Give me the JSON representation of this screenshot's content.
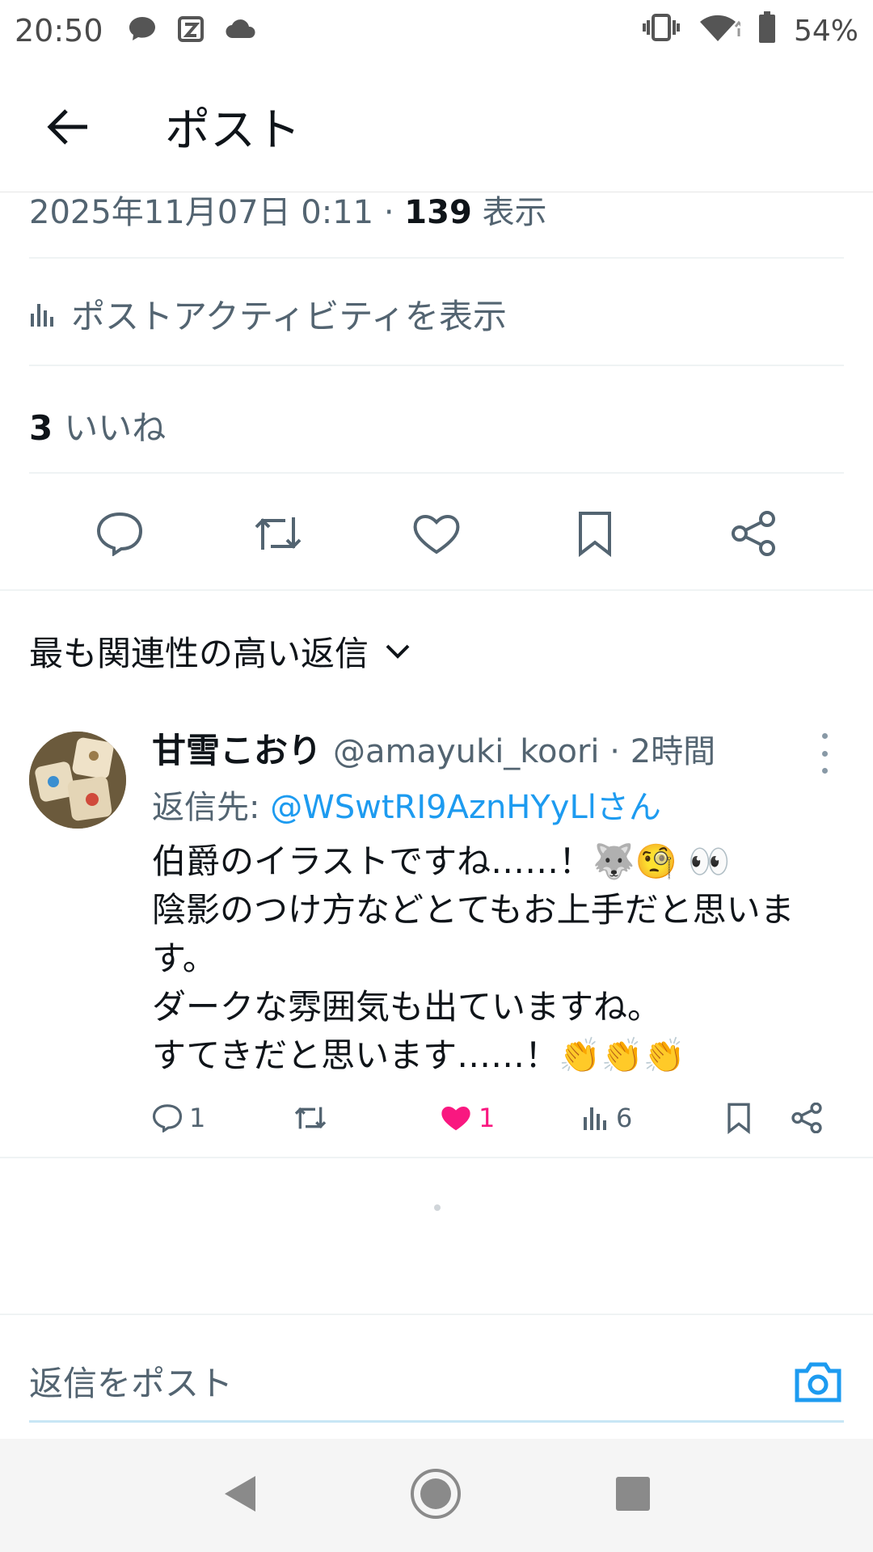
{
  "status_bar": {
    "time": "20:50",
    "battery": "54%",
    "left_icons": [
      "message-bubble-icon",
      "app-notification-icon",
      "cloud-icon"
    ],
    "right_icons": [
      "vibrate-icon",
      "wifi-icon",
      "battery-icon"
    ]
  },
  "app_bar": {
    "title": "ポスト",
    "back_icon": "arrow-left-icon"
  },
  "post_meta": {
    "datetime": "2025年11月07日 0:11 · ",
    "views_count": "139",
    "views_label": "表示"
  },
  "activity": {
    "label": "ポストアクティビティを表示",
    "icon": "bar-chart-icon"
  },
  "likes": {
    "count": "3",
    "label": "いいね"
  },
  "post_actions": [
    "reply-icon",
    "repost-icon",
    "like-icon",
    "bookmark-icon",
    "share-icon"
  ],
  "sort": {
    "label": "最も関連性の高い返信",
    "icon": "chevron-down-icon"
  },
  "reply": {
    "display_name": "甘雪こおり",
    "handle": "@amayuki_koori",
    "time": "· 2時間",
    "reply_to_prefix": "返信先: ",
    "reply_to_user": "@WSwtRI9AznHYyLlさん",
    "text": "伯爵のイラストですね……！🐺🧐 👀\n陰影のつけ方などとてもお上手だと思います。\nダークな雰囲気も出ていますね。\nすてきだと思います……！👏👏👏",
    "replies": "1",
    "likes": "1",
    "views": "6",
    "liked": true,
    "colors": {
      "like": "#f91880",
      "mention": "#1d9bf0"
    }
  },
  "composer": {
    "placeholder": "返信をポスト",
    "camera_icon": "camera-icon",
    "accent": "#1d9bf0"
  },
  "nav_bar": [
    "nav-back-icon",
    "nav-home-icon",
    "nav-recents-icon"
  ]
}
